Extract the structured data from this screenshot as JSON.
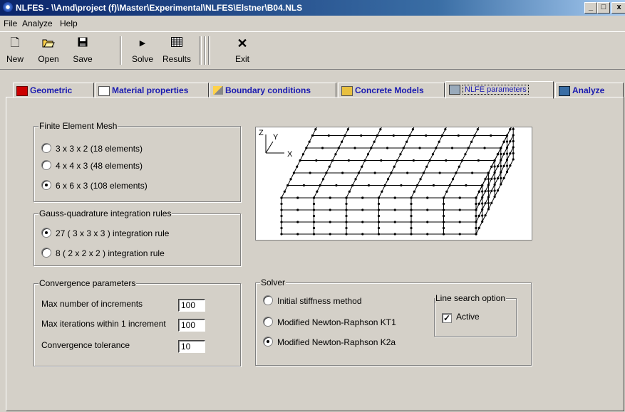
{
  "window": {
    "title": "NLFES - \\\\Amd\\project (f)\\Master\\Experimental\\NLFES\\Elstner\\B04.NLS"
  },
  "menu": [
    "File",
    "Analyze",
    "Help"
  ],
  "toolbar": {
    "new": "New",
    "open": "Open",
    "save": "Save",
    "solve": "Solve",
    "results": "Results",
    "exit": "Exit"
  },
  "tabs": [
    {
      "label": "Geometric",
      "icon": "geometry-icon"
    },
    {
      "label": "Material properties",
      "icon": "material-icon"
    },
    {
      "label": "Boundary conditions",
      "icon": "boundary-icon"
    },
    {
      "label": "Concrete Models",
      "icon": "concrete-icon"
    },
    {
      "label": "NLFE parameters",
      "icon": "parameters-icon",
      "active": true
    },
    {
      "label": "Analyze",
      "icon": "calculator-icon"
    }
  ],
  "mesh": {
    "title": "Finite Element Mesh",
    "options": [
      "3 x 3 x 2 (18 elements)",
      "4 x 4 x 3 (48 elements)",
      "6 x 6 x 3 (108 elements)"
    ],
    "selected": 2
  },
  "gauss": {
    "title": "Gauss-quadrature integration rules",
    "options": [
      "27 ( 3 x 3 x 3 ) integration rule",
      "8 ( 2 x 2 x 2 ) integration rule"
    ],
    "selected": 0
  },
  "convergence": {
    "title": "Convergence parameters",
    "max_increments_label": "Max number of increments",
    "max_increments_value": "100",
    "max_iterations_label": "Max iterations within 1 increment",
    "max_iterations_value": "100",
    "tolerance_label": "Convergence tolerance",
    "tolerance_value": "10"
  },
  "solver": {
    "title": "Solver",
    "options": [
      "Initial stiffness method",
      "Modified Newton-Raphson KT1",
      "Modified Newton-Raphson K2a"
    ],
    "selected": 2
  },
  "line_search": {
    "title": "Line search option",
    "active_label": "Active",
    "checked": true
  },
  "axes": {
    "z": "Z",
    "y": "Y",
    "x": "X"
  }
}
